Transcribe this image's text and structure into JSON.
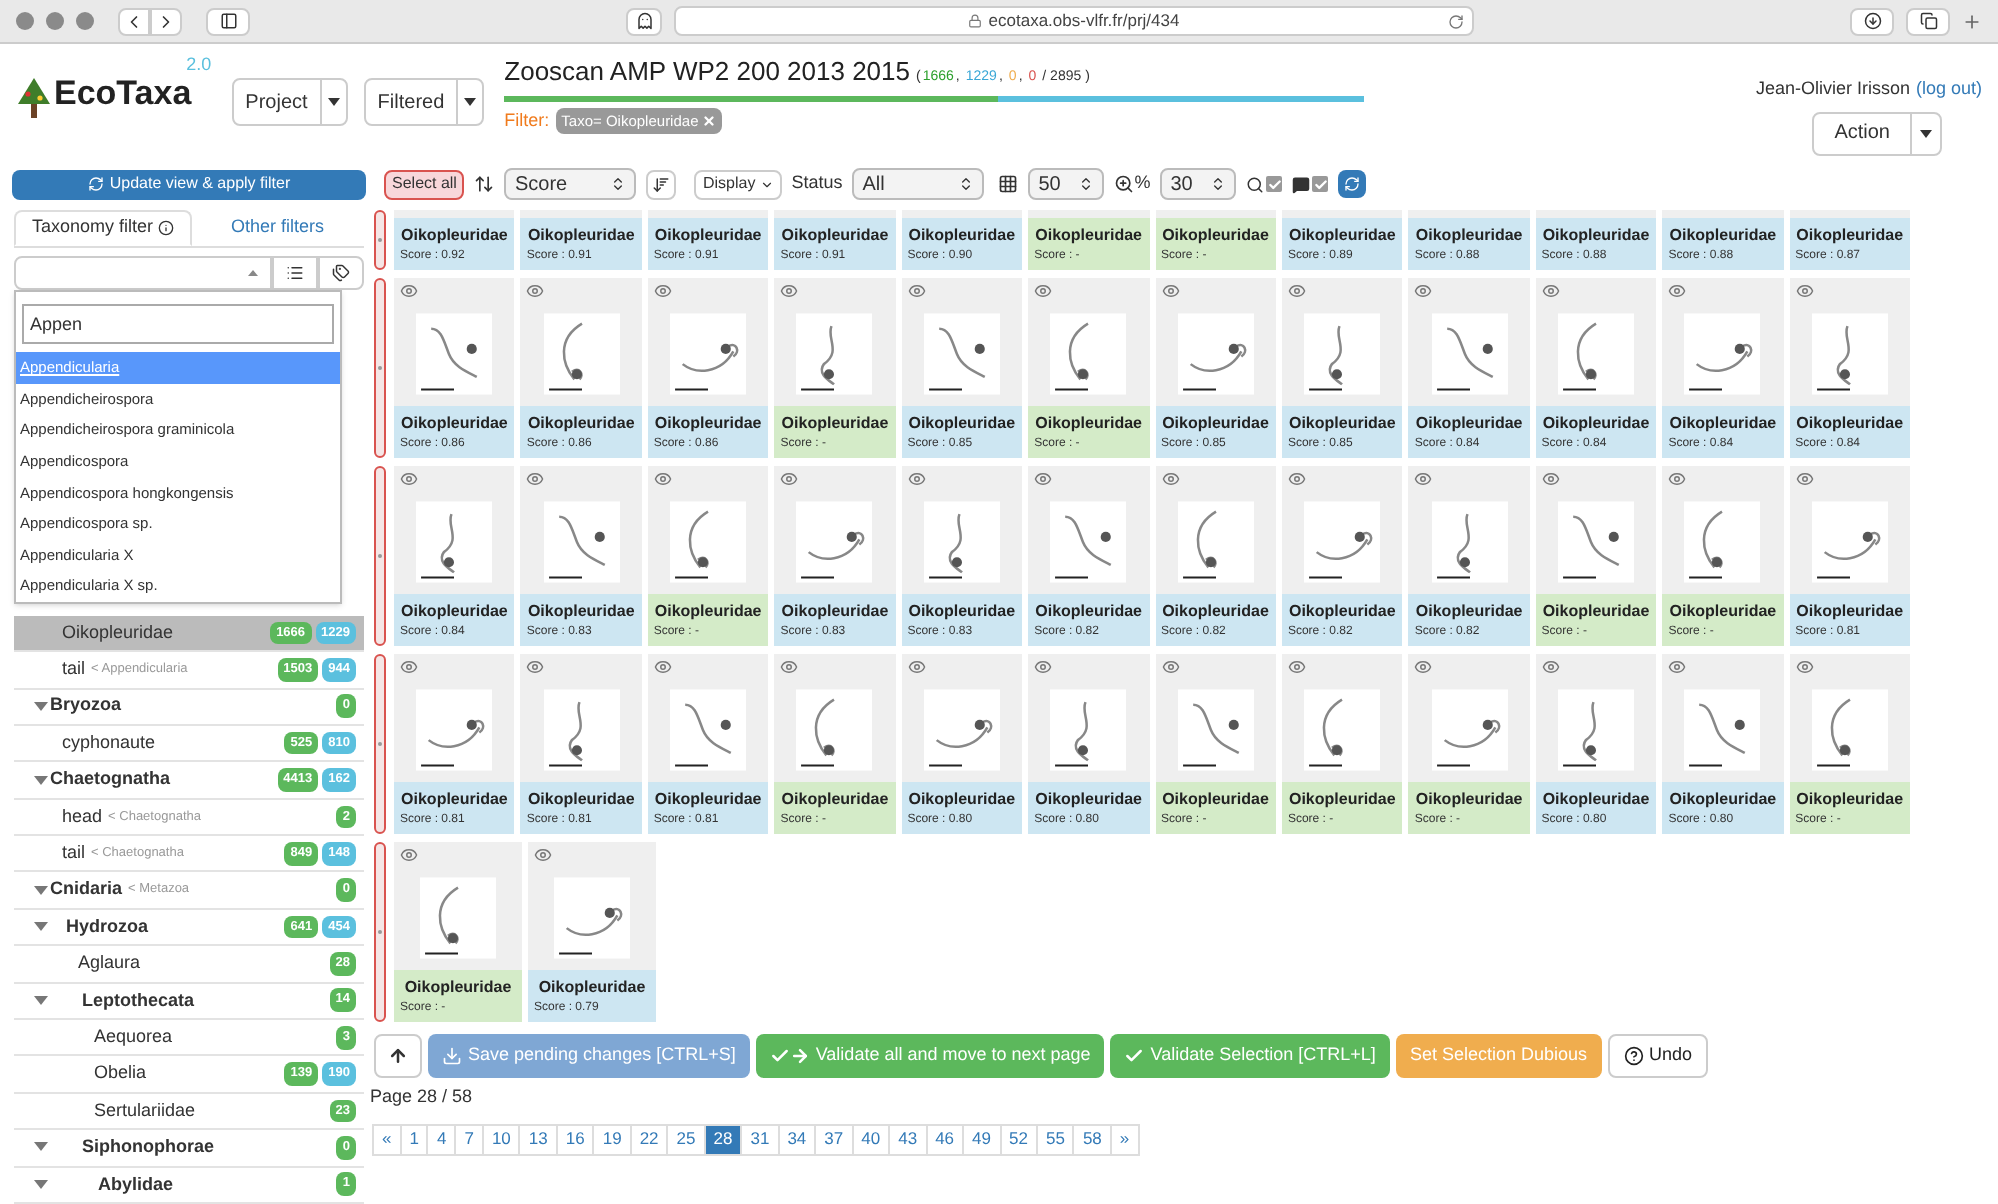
{
  "browser": {
    "url": "ecotaxa.obs-vlfr.fr/prj/434"
  },
  "header": {
    "logo": "EcoTaxa",
    "version": "2.0",
    "menus": [
      "Project",
      "Filtered"
    ],
    "title": "Zooscan AMP WP2 200 2013 2015",
    "counts_open": "(",
    "counts": [
      {
        "text": "1666",
        "sep": ",",
        "color": "#2ca02c"
      },
      {
        "text": "1229",
        "sep": ",",
        "color": "#3aa7d6"
      },
      {
        "text": "0",
        "sep": ",",
        "color": "#f0ad4e"
      },
      {
        "text": "0",
        "color": "#d9534f"
      }
    ],
    "total": "/ 2895 )",
    "progress": [
      {
        "level": 0.575,
        "color": "#5cb85c"
      },
      {
        "level": 0.425,
        "color": "#5bc0de"
      }
    ],
    "filter_label": "Filter:",
    "filter_tag": "Taxo= Oikopleuridae",
    "user": "Jean-Olivier Irisson",
    "logout": "(log out)",
    "action": "Action"
  },
  "toolbar": {
    "update": "Update view & apply filter",
    "select_all": "Select all",
    "sort": "Score",
    "display": "Display",
    "status_label": "Status",
    "status": "All",
    "per_page": "50",
    "zoom_label": "%",
    "zoom": "30",
    "search_checked": true,
    "comment_checked": true
  },
  "sidebar": {
    "tabs": [
      {
        "label": "Taxonomy filter",
        "selected": true
      },
      {
        "label": "Other filters",
        "selected": false
      }
    ],
    "search": {
      "value": "Appen"
    },
    "options": [
      {
        "label": "Appendicularia",
        "selected": true
      },
      {
        "label": "Appendicheirospora",
        "selected": false
      },
      {
        "label": "Appendicheirospora graminicola",
        "selected": false
      },
      {
        "label": "Appendicospora",
        "selected": false
      },
      {
        "label": "Appendicospora hongkongensis",
        "selected": false
      },
      {
        "label": "Appendicospora sp.",
        "selected": false
      },
      {
        "label": "Appendicularia X",
        "selected": false
      },
      {
        "label": "Appendicularia X sp.",
        "selected": false
      }
    ],
    "tree": [
      {
        "name": "Oikopleuridae",
        "selected": true,
        "green": "1666",
        "blue": "1229"
      },
      {
        "name": "tail",
        "parent": "< Appendicularia",
        "selected": false,
        "green": "1503",
        "blue": "944"
      },
      {
        "name": "Bryozoa",
        "selected": false,
        "expanded": true,
        "green": "0",
        "children": [
          {
            "name": "cyphonaute",
            "selected": false,
            "green": "525",
            "blue": "810"
          }
        ]
      },
      {
        "name": "Chaetognatha",
        "selected": false,
        "expanded": true,
        "green": "4413",
        "blue": "162",
        "children": [
          {
            "name": "head",
            "parent": "< Chaetognatha",
            "selected": false,
            "green": "2"
          },
          {
            "name": "tail",
            "parent": "< Chaetognatha",
            "selected": false,
            "green": "849",
            "blue": "148"
          }
        ]
      },
      {
        "name": "Cnidaria",
        "parent": "< Metazoa",
        "selected": false,
        "expanded": true,
        "green": "0",
        "children": [
          {
            "name": "Hydrozoa",
            "selected": false,
            "expanded": true,
            "green": "641",
            "blue": "454",
            "children": [
              {
                "name": "Aglaura",
                "selected": false,
                "green": "28"
              },
              {
                "name": "Leptothecata",
                "selected": false,
                "expanded": true,
                "green": "14",
                "children": [
                  {
                    "name": "Aequorea",
                    "selected": false,
                    "green": "3"
                  },
                  {
                    "name": "Obelia",
                    "selected": false,
                    "green": "139",
                    "blue": "190"
                  },
                  {
                    "name": "Sertulariidae",
                    "selected": false,
                    "green": "23"
                  }
                ]
              },
              {
                "name": "Siphonophorae",
                "selected": false,
                "expanded": true,
                "green": "0",
                "children": [
                  {
                    "name": "Abylidae",
                    "selected": false,
                    "expanded": true,
                    "green": "1"
                  }
                ]
              }
            ]
          }
        ]
      }
    ]
  },
  "grid": {
    "rows": [
      {
        "kind": "partial",
        "cards": [
          {
            "label": "Oikopleuridae",
            "score": "Score : 0.92",
            "validated": false
          },
          {
            "label": "Oikopleuridae",
            "score": "Score : 0.91",
            "validated": false
          },
          {
            "label": "Oikopleuridae",
            "score": "Score : 0.91",
            "validated": false
          },
          {
            "label": "Oikopleuridae",
            "score": "Score : 0.91",
            "validated": false
          },
          {
            "label": "Oikopleuridae",
            "score": "Score : 0.90",
            "validated": false
          },
          {
            "label": "Oikopleuridae",
            "score": "Score : -",
            "validated": true
          },
          {
            "label": "Oikopleuridae",
            "score": "Score : -",
            "validated": true
          },
          {
            "label": "Oikopleuridae",
            "score": "Score : 0.89",
            "validated": false
          },
          {
            "label": "Oikopleuridae",
            "score": "Score : 0.88",
            "validated": false
          },
          {
            "label": "Oikopleuridae",
            "score": "Score : 0.88",
            "validated": false
          },
          {
            "label": "Oikopleuridae",
            "score": "Score : 0.88",
            "validated": false
          },
          {
            "label": "Oikopleuridae",
            "score": "Score : 0.87",
            "validated": false
          }
        ]
      },
      {
        "kind": "full",
        "cards": [
          {
            "label": "Oikopleuridae",
            "score": "Score : 0.86",
            "validated": false
          },
          {
            "label": "Oikopleuridae",
            "score": "Score : 0.86",
            "validated": false
          },
          {
            "label": "Oikopleuridae",
            "score": "Score : 0.86",
            "validated": false
          },
          {
            "label": "Oikopleuridae",
            "score": "Score : -",
            "validated": true
          },
          {
            "label": "Oikopleuridae",
            "score": "Score : 0.85",
            "validated": false
          },
          {
            "label": "Oikopleuridae",
            "score": "Score : -",
            "validated": true
          },
          {
            "label": "Oikopleuridae",
            "score": "Score : 0.85",
            "validated": false
          },
          {
            "label": "Oikopleuridae",
            "score": "Score : 0.85",
            "validated": false
          },
          {
            "label": "Oikopleuridae",
            "score": "Score : 0.84",
            "validated": false
          },
          {
            "label": "Oikopleuridae",
            "score": "Score : 0.84",
            "validated": false
          },
          {
            "label": "Oikopleuridae",
            "score": "Score : 0.84",
            "validated": false
          },
          {
            "label": "Oikopleuridae",
            "score": "Score : 0.84",
            "validated": false
          }
        ]
      },
      {
        "kind": "full",
        "cards": [
          {
            "label": "Oikopleuridae",
            "score": "Score : 0.84",
            "validated": false
          },
          {
            "label": "Oikopleuridae",
            "score": "Score : 0.83",
            "validated": false
          },
          {
            "label": "Oikopleuridae",
            "score": "Score : -",
            "validated": true
          },
          {
            "label": "Oikopleuridae",
            "score": "Score : 0.83",
            "validated": false
          },
          {
            "label": "Oikopleuridae",
            "score": "Score : 0.83",
            "validated": false
          },
          {
            "label": "Oikopleuridae",
            "score": "Score : 0.82",
            "validated": false
          },
          {
            "label": "Oikopleuridae",
            "score": "Score : 0.82",
            "validated": false
          },
          {
            "label": "Oikopleuridae",
            "score": "Score : 0.82",
            "validated": false
          },
          {
            "label": "Oikopleuridae",
            "score": "Score : 0.82",
            "validated": false
          },
          {
            "label": "Oikopleuridae",
            "score": "Score : -",
            "validated": true
          },
          {
            "label": "Oikopleuridae",
            "score": "Score : -",
            "validated": true
          },
          {
            "label": "Oikopleuridae",
            "score": "Score : 0.81",
            "validated": false
          }
        ]
      },
      {
        "kind": "full",
        "cards": [
          {
            "label": "Oikopleuridae",
            "score": "Score : 0.81",
            "validated": false
          },
          {
            "label": "Oikopleuridae",
            "score": "Score : 0.81",
            "validated": false
          },
          {
            "label": "Oikopleuridae",
            "score": "Score : 0.81",
            "validated": false
          },
          {
            "label": "Oikopleuridae",
            "score": "Score : -",
            "validated": true
          },
          {
            "label": "Oikopleuridae",
            "score": "Score : 0.80",
            "validated": false
          },
          {
            "label": "Oikopleuridae",
            "score": "Score : 0.80",
            "validated": false
          },
          {
            "label": "Oikopleuridae",
            "score": "Score : -",
            "validated": true
          },
          {
            "label": "Oikopleuridae",
            "score": "Score : -",
            "validated": true
          },
          {
            "label": "Oikopleuridae",
            "score": "Score : -",
            "validated": true
          },
          {
            "label": "Oikopleuridae",
            "score": "Score : 0.80",
            "validated": false
          },
          {
            "label": "Oikopleuridae",
            "score": "Score : 0.80",
            "validated": false
          },
          {
            "label": "Oikopleuridae",
            "score": "Score : -",
            "validated": true
          }
        ]
      },
      {
        "kind": "full",
        "cards": [
          {
            "label": "Oikopleuridae",
            "score": "Score : -",
            "validated": true
          },
          {
            "label": "Oikopleuridae",
            "score": "Score : 0.79",
            "validated": false
          }
        ]
      }
    ]
  },
  "actions": [
    {
      "kind": "save",
      "label": "Save pending changes [CTRL+S]"
    },
    {
      "kind": "validate_all",
      "label": "Validate all and move to next page"
    },
    {
      "kind": "validate",
      "label": "Validate Selection [CTRL+L]"
    },
    {
      "kind": "dubious",
      "label": "Set Selection Dubious"
    },
    {
      "kind": "undo",
      "label": "Undo"
    }
  ],
  "page_info": "Page 28 / 58",
  "pagination": [
    {
      "label": "«",
      "selected": false
    },
    {
      "label": "1",
      "selected": false
    },
    {
      "label": "4",
      "selected": false
    },
    {
      "label": "7",
      "selected": false
    },
    {
      "label": "10",
      "selected": false
    },
    {
      "label": "13",
      "selected": false
    },
    {
      "label": "16",
      "selected": false
    },
    {
      "label": "19",
      "selected": false
    },
    {
      "label": "22",
      "selected": false
    },
    {
      "label": "25",
      "selected": false
    },
    {
      "label": "28",
      "selected": true
    },
    {
      "label": "31",
      "selected": false
    },
    {
      "label": "34",
      "selected": false
    },
    {
      "label": "37",
      "selected": false
    },
    {
      "label": "40",
      "selected": false
    },
    {
      "label": "43",
      "selected": false
    },
    {
      "label": "46",
      "selected": false
    },
    {
      "label": "49",
      "selected": false
    },
    {
      "label": "52",
      "selected": false
    },
    {
      "label": "55",
      "selected": false
    },
    {
      "label": "58",
      "selected": false
    },
    {
      "label": "»",
      "selected": false
    }
  ]
}
